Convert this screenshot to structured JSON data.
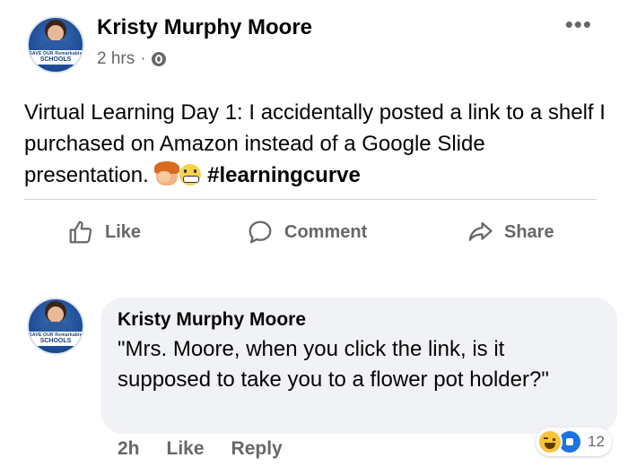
{
  "post": {
    "author": "Kristy Murphy Moore",
    "time": "2 hrs",
    "separator": "·",
    "more_glyph": "•••",
    "avatar_badge_top": "SAVE OUR Remarkable",
    "avatar_badge_bottom": "SCHOOLS",
    "text": "Virtual Learning Day 1: I accidentally posted a link to a shelf I purchased on Amazon instead of a Google Slide presentation.",
    "emojis": [
      "facepalm-emoji",
      "grimace-emoji"
    ],
    "hashtag": "#learningcurve"
  },
  "actions": {
    "like": "Like",
    "comment": "Comment",
    "share": "Share"
  },
  "comment": {
    "author": "Kristy Murphy Moore",
    "text": "\"Mrs. Moore, when you click the link, is it supposed to take you to a flower pot holder?\"",
    "time": "2h",
    "like": "Like",
    "reply": "Reply",
    "reaction_count": "12",
    "reactions": [
      "haha-reaction",
      "like-reaction"
    ]
  },
  "colors": {
    "secondary_text": "#65676b",
    "comment_bg": "#f0f2f5",
    "like_blue": "#1b74e4"
  }
}
